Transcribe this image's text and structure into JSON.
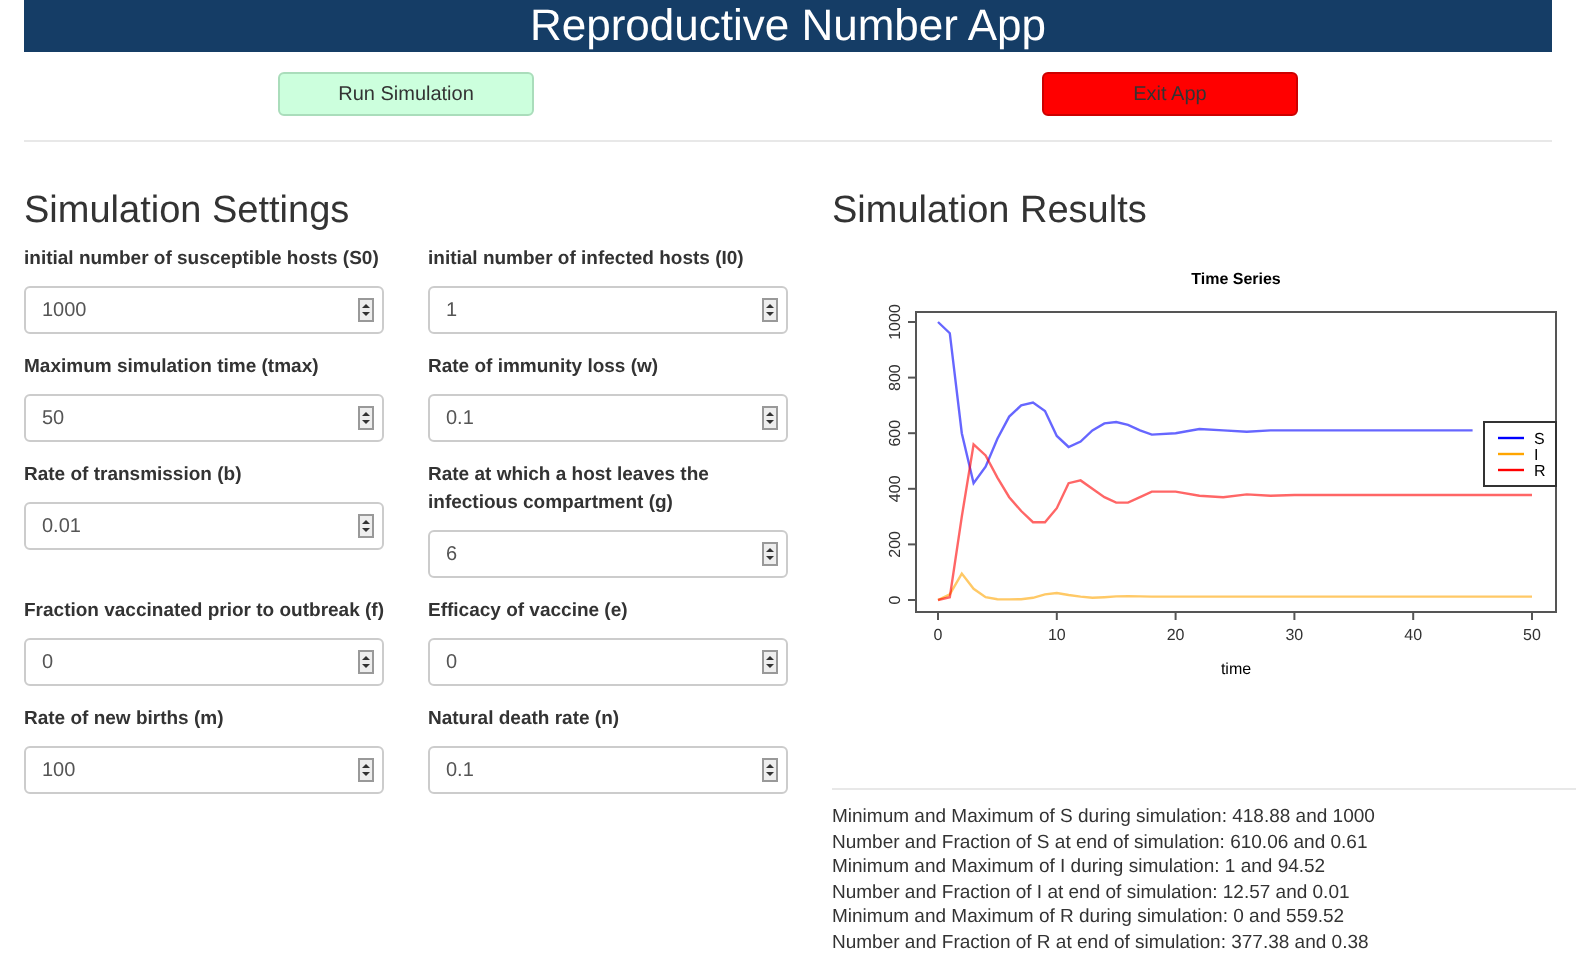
{
  "header": {
    "title": "Reproductive Number App"
  },
  "buttons": [
    {
      "label": "Run Simulation",
      "kind": "run"
    },
    {
      "label": "Exit App",
      "kind": "exit"
    }
  ],
  "settings": {
    "title": "Simulation Settings",
    "fields": [
      {
        "label": "initial number of susceptible hosts (S0)",
        "value": "1000"
      },
      {
        "label": "initial number of infected hosts (I0)",
        "value": "1"
      },
      {
        "label": "Maximum simulation time (tmax)",
        "value": "50"
      },
      {
        "label": "Rate of immunity loss (w)",
        "value": "0.1"
      },
      {
        "label": "Rate of transmission (b)",
        "value": "0.01"
      },
      {
        "label": "Rate at which a host leaves the infectious compartment (g)",
        "value": "6"
      },
      {
        "label": "Fraction vaccinated prior to outbreak (f)",
        "value": "0"
      },
      {
        "label": "Efficacy of vaccine (e)",
        "value": "0"
      },
      {
        "label": "Rate of new births (m)",
        "value": "100"
      },
      {
        "label": "Natural death rate (n)",
        "value": "0.1"
      }
    ]
  },
  "results": {
    "title": "Simulation Results",
    "chart_data": {
      "type": "line",
      "title": "Time Series",
      "legend": true,
      "xlabel": "time",
      "xlim": [
        0,
        50
      ],
      "ylim": [
        0,
        1000
      ],
      "xticks": [
        0,
        10,
        20,
        30,
        40,
        50
      ],
      "yticks": [
        0,
        200,
        400,
        600,
        800,
        1000
      ],
      "x": [
        0,
        1,
        2,
        3,
        4,
        5,
        6,
        7,
        8,
        9,
        10,
        11,
        12,
        13,
        14,
        15,
        16,
        17,
        18,
        20,
        22,
        24,
        26,
        28,
        30,
        35,
        40,
        45,
        50
      ],
      "series": [
        {
          "name": "S",
          "color": "#0000ff",
          "values": [
            1000,
            960,
            600,
            420,
            480,
            580,
            660,
            700,
            710,
            680,
            590,
            550,
            570,
            610,
            635,
            640,
            630,
            610,
            595,
            600,
            615,
            610,
            605,
            610,
            610,
            610,
            610,
            610,
            null
          ]
        },
        {
          "name": "I",
          "color": "#ffa500",
          "values": [
            0,
            20,
            95,
            40,
            10,
            3,
            2,
            3,
            8,
            20,
            25,
            18,
            12,
            8,
            10,
            13,
            14,
            13,
            12,
            12,
            12,
            12,
            12,
            12,
            12,
            12,
            12,
            12,
            12
          ]
        },
        {
          "name": "R",
          "color": "#ff0000",
          "values": [
            0,
            10,
            300,
            560,
            520,
            440,
            370,
            320,
            280,
            280,
            330,
            420,
            430,
            400,
            370,
            350,
            350,
            370,
            390,
            390,
            375,
            370,
            380,
            375,
            378,
            378,
            378,
            378,
            378
          ]
        }
      ]
    },
    "summary": [
      "Minimum and Maximum of S during simulation: 418.88 and 1000",
      "Number and Fraction of S at end of simulation: 610.06 and 0.61",
      "Minimum and Maximum of I during simulation: 1 and 94.52",
      "Number and Fraction of I at end of simulation: 12.57 and 0.01",
      "Minimum and Maximum of R during simulation: 0 and 559.52",
      "Number and Fraction of R at end of simulation: 377.38 and 0.38"
    ]
  }
}
